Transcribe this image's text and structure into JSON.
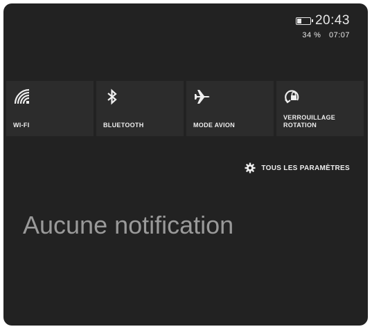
{
  "status": {
    "time": "20:43",
    "battery_percent_text": "34 %",
    "battery_level": 0.34,
    "secondary_time": "07:07"
  },
  "tiles": [
    {
      "label": "WI-FI",
      "icon": "wifi-icon"
    },
    {
      "label": "BLUETOOTH",
      "icon": "bluetooth-icon"
    },
    {
      "label": "MODE AVION",
      "icon": "airplane-icon"
    },
    {
      "label": "VERROUILLAGE ROTATION",
      "icon": "rotation-lock-icon"
    }
  ],
  "settings": {
    "label": "TOUS LES PARAMÈTRES",
    "icon": "gear-icon"
  },
  "notifications": {
    "empty_text": "Aucune notification"
  },
  "colors": {
    "background": "#222222",
    "tile": "#2c2c2c",
    "text": "#e8e8e8",
    "muted_text": "#9a9a9a"
  }
}
